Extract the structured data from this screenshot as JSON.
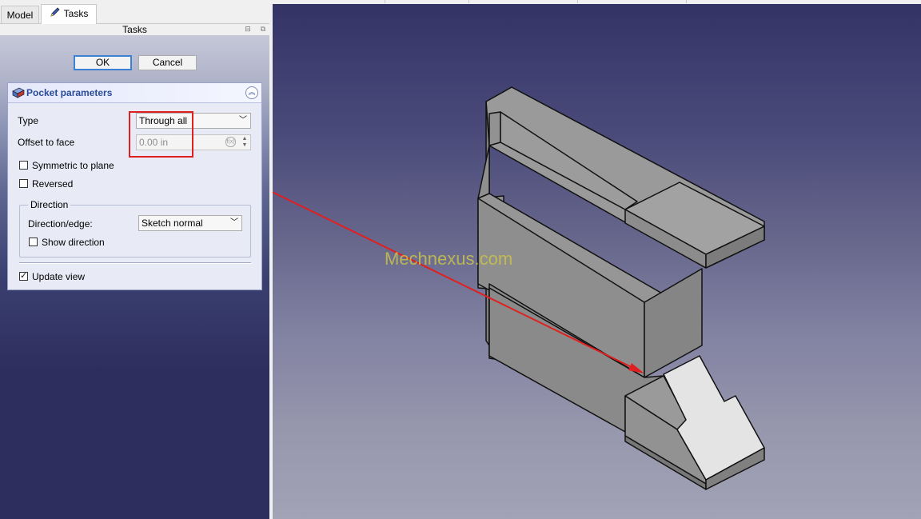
{
  "tabs": {
    "model": "Model",
    "tasks": "Tasks"
  },
  "panel_title": "Tasks",
  "buttons": {
    "ok": "OK",
    "cancel": "Cancel"
  },
  "pocket": {
    "title": "Pocket parameters",
    "type_label": "Type",
    "type_value": "Through all",
    "offset_label": "Offset to face",
    "offset_value": "0.00 in",
    "symmetric_label": "Symmetric to plane",
    "symmetric_checked": false,
    "reversed_label": "Reversed",
    "reversed_checked": false,
    "direction_group": "Direction",
    "direction_edge_label": "Direction/edge:",
    "direction_edge_value": "Sketch normal",
    "show_direction_label": "Show direction",
    "show_direction_checked": false,
    "update_view_label": "Update view",
    "update_view_checked": true
  },
  "viewport": {
    "watermark": "Mechnexus.com"
  },
  "colors": {
    "highlight": "#e02020",
    "face_light": "#a0a0a0",
    "face_mid": "#909090",
    "face_dark": "#7f7f7f",
    "face_selected": "#e4e4e4"
  },
  "icons": {
    "tasks_tab": "pencil-icon",
    "pocket": "pocket-icon",
    "collapse": "collapse-up-icon"
  }
}
